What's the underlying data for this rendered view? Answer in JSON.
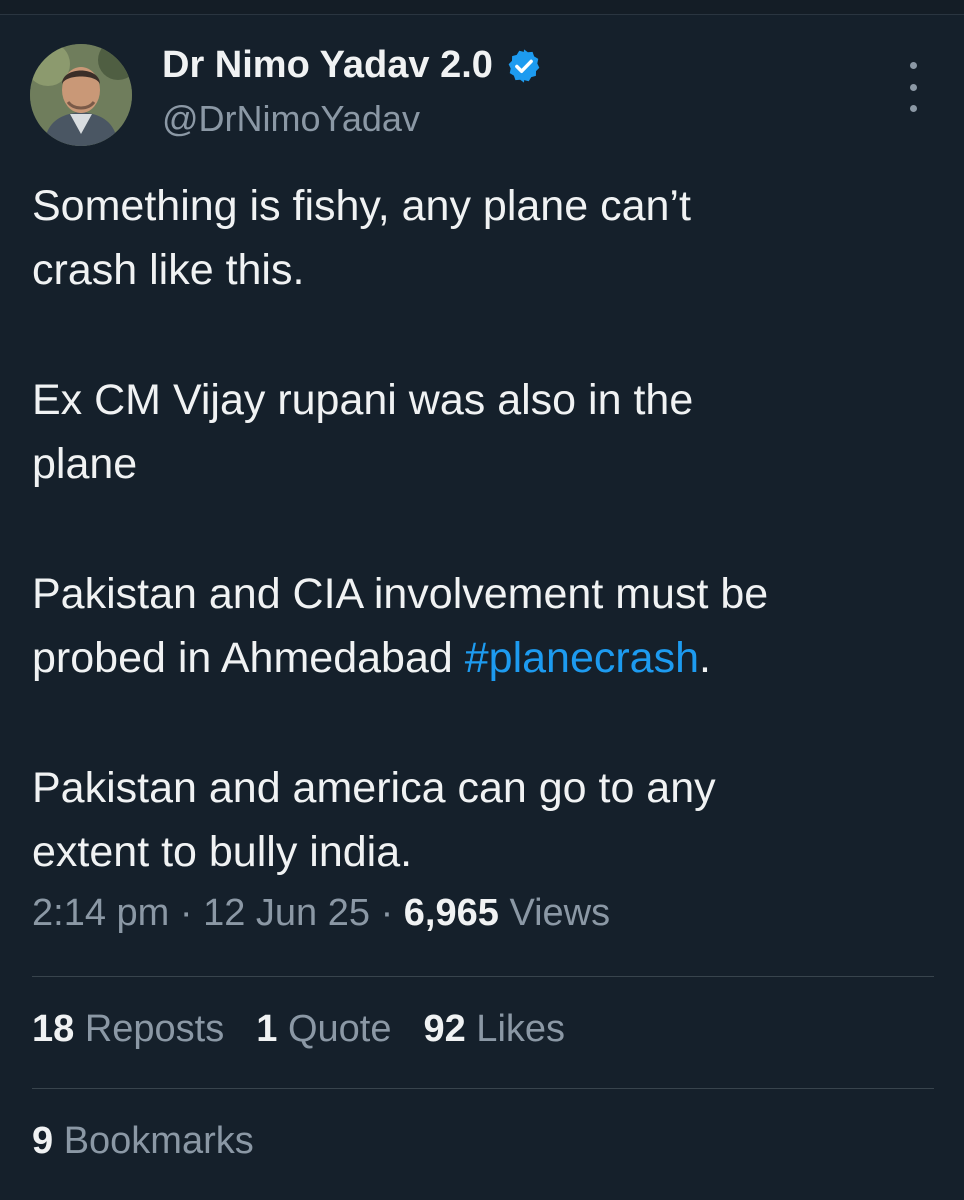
{
  "author": {
    "display_name": "Dr Nimo Yadav 2.0",
    "handle": "@DrNimoYadav",
    "verified_icon": "verified-badge-icon"
  },
  "tweet": {
    "lines_p1": [
      "Something is fishy, any plane can’t",
      "crash like this."
    ],
    "lines_p2": [
      "Ex CM Vijay rupani was also in the",
      "plane"
    ],
    "p3_line1": "Pakistan and CIA involvement must be",
    "p3_line2_text": "probed in Ahmedabad ",
    "p3_hashtag": "#planecrash",
    "p3_end": ".",
    "lines_p4": [
      "Pakistan and america can go to any",
      "extent to bully india."
    ]
  },
  "meta": {
    "time": "2:14 pm",
    "sep1": " · ",
    "date": "12 Jun 25",
    "sep2": " · ",
    "views_count": "6,965",
    "views_label": " Views"
  },
  "stats": {
    "reposts_count": "18",
    "reposts_label": " Reposts",
    "quotes_count": "1",
    "quotes_label": " Quote",
    "likes_count": "92",
    "likes_label": " Likes",
    "bookmarks_count": "9",
    "bookmarks_label": " Bookmarks"
  },
  "colors": {
    "background": "#15202b",
    "text": "#f0f2f3",
    "secondary": "#8b98a5",
    "accent": "#1d9bf0",
    "divider": "#38444d"
  }
}
